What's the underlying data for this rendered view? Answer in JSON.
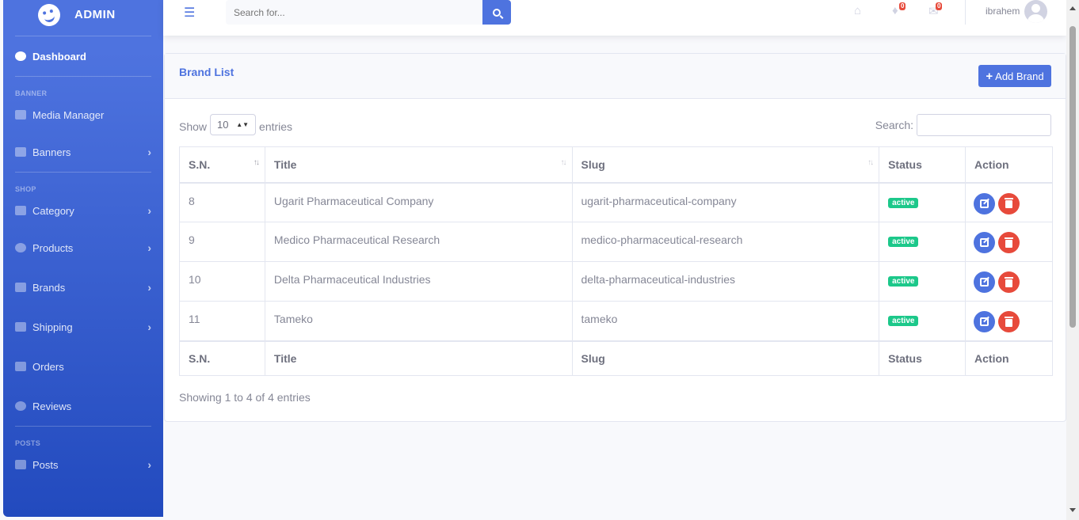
{
  "sidebar": {
    "brand": "ADMIN",
    "dashboard": "Dashboard",
    "headings": {
      "banner": "BANNER",
      "shop": "SHOP",
      "posts": "POSTS"
    },
    "items": {
      "media_manager": "Media Manager",
      "banners": "Banners",
      "category": "Category",
      "products": "Products",
      "brands": "Brands",
      "shipping": "Shipping",
      "orders": "Orders",
      "reviews": "Reviews",
      "posts": "Posts"
    }
  },
  "topbar": {
    "search_placeholder": "Search for...",
    "alerts_count": "0",
    "messages_count": "0",
    "user_name": "ibrahem"
  },
  "card": {
    "title": "Brand List",
    "add_label": "Add Brand"
  },
  "datatable": {
    "show_label": "Show",
    "entries_value": "10",
    "entries_label": "entries",
    "search_label": "Search:",
    "columns": {
      "sn": "S.N.",
      "title": "Title",
      "slug": "Slug",
      "status": "Status",
      "action": "Action"
    },
    "rows": [
      {
        "sn": "8",
        "title": "Ugarit Pharmaceutical Company",
        "slug": "ugarit-pharmaceutical-company",
        "status": "active"
      },
      {
        "sn": "9",
        "title": "Medico Pharmaceutical Research",
        "slug": "medico-pharmaceutical-research",
        "status": "active"
      },
      {
        "sn": "10",
        "title": "Delta Pharmaceutical Industries",
        "slug": "delta-pharmaceutical-industries",
        "status": "active"
      },
      {
        "sn": "11",
        "title": "Tameko",
        "slug": "tameko",
        "status": "active"
      }
    ],
    "info": "Showing 1 to 4 of 4 entries"
  }
}
